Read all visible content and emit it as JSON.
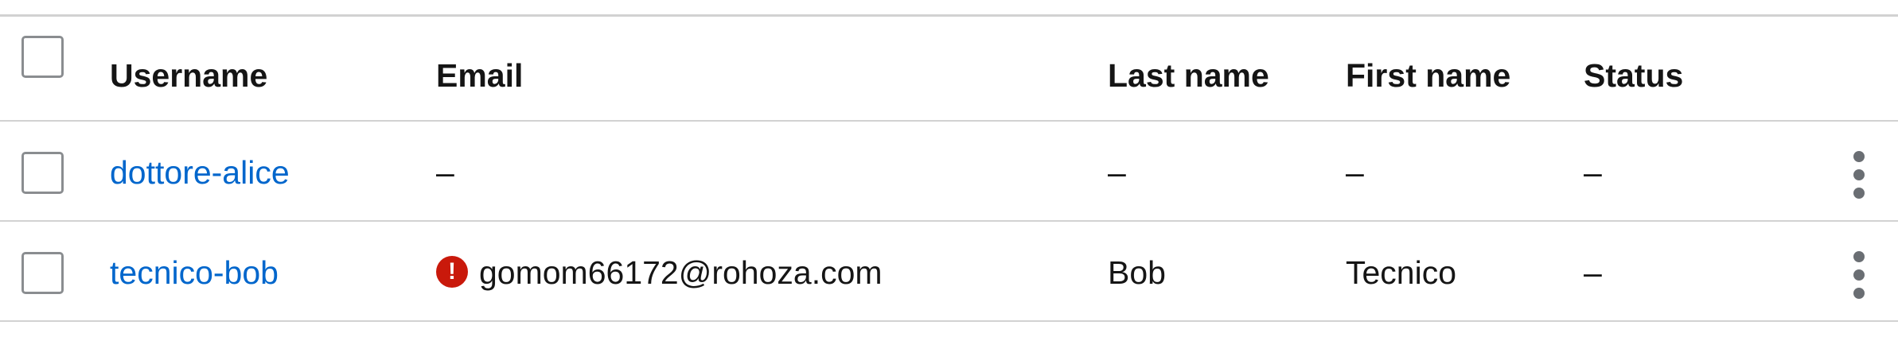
{
  "table": {
    "headers": {
      "username": "Username",
      "email": "Email",
      "last_name": "Last name",
      "first_name": "First name",
      "status": "Status"
    },
    "rows": [
      {
        "username": "dottore-alice",
        "email": "–",
        "last_name": "–",
        "first_name": "–",
        "status": "–",
        "email_error": false
      },
      {
        "username": "tecnico-bob",
        "email": "gomom66172@rohoza.com",
        "last_name": "Bob",
        "first_name": "Tecnico",
        "status": "–",
        "email_error": true
      }
    ]
  },
  "icons": {
    "error": "exclamation-circle-icon",
    "actions": "kebab-menu-icon"
  },
  "colors": {
    "link": "#0066cc",
    "error": "#c9190b",
    "border": "#d2d2d2"
  }
}
